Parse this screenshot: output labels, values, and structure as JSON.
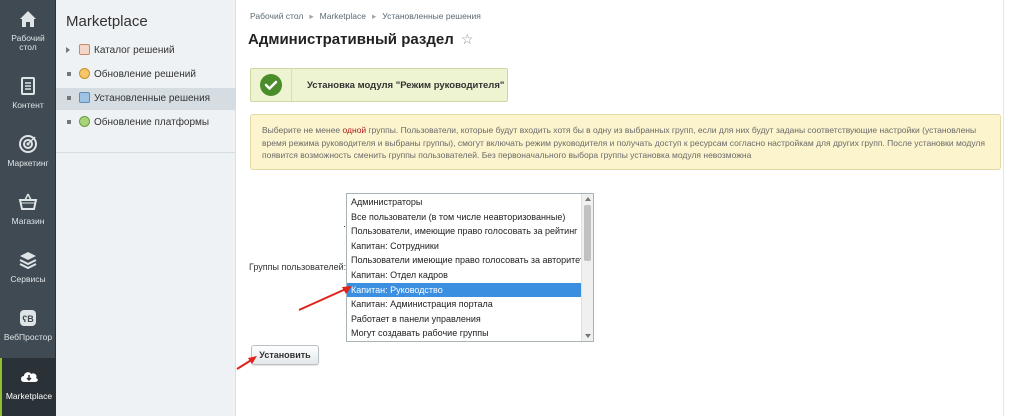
{
  "nav": {
    "items": [
      {
        "label": "Рабочий стол",
        "icon": "home-icon"
      },
      {
        "label": "Контент",
        "icon": "document-icon"
      },
      {
        "label": "Маркетинг",
        "icon": "target-icon"
      },
      {
        "label": "Магазин",
        "icon": "basket-icon"
      },
      {
        "label": "Сервисы",
        "icon": "layers-icon"
      },
      {
        "label": "ВебПростор",
        "icon": "webprostor-icon"
      },
      {
        "label": "Marketplace",
        "icon": "cloud-download-icon",
        "active": true
      }
    ]
  },
  "submenu": {
    "title": "Marketplace",
    "items": [
      {
        "label": "Каталог решений",
        "icon": "catalog-icon"
      },
      {
        "label": "Обновление решений",
        "icon": "update-icon"
      },
      {
        "label": "Установленные решения",
        "icon": "installed-icon",
        "selected": true
      },
      {
        "label": "Обновление платформы",
        "icon": "platform-icon"
      }
    ]
  },
  "breadcrumb": [
    "Рабочий стол",
    "Marketplace",
    "Установленные решения"
  ],
  "page": {
    "title": "Административный раздел"
  },
  "success": {
    "message": "Установка модуля \"Режим руководителя\""
  },
  "warning": {
    "before": "Выберите не менее ",
    "highlight": "одной",
    "after": " группы. Пользователи, которые будут входить хотя бы в одну из выбранных групп, если для них будут заданы соответствующие настройки (установлены время режима руководителя и выбраны группы), смогут включать режим руководителя и получать доступ к ресурсам согласно настройкам для других групп. После установки модуля появится возможность сменить группы пользователей. Без первоначального выбора группы установка модуля невозможна"
  },
  "form": {
    "groups_label": "Группы пользователей:",
    "options": [
      "Администраторы",
      "Все пользователи (в том числе неавторизованные)",
      "Пользователи, имеющие право голосовать за рейтинг",
      "Капитан: Сотрудники",
      "Пользователи имеющие право голосовать за авторитет",
      "Капитан: Отдел кадров",
      "Капитан: Руководство",
      "Капитан: Администрация портала",
      "Работает в панели управления",
      "Могут создавать рабочие группы"
    ],
    "selected_index": 6,
    "install_button": "Установить"
  },
  "colors": {
    "nav_bg": "#3f4a52",
    "accent_green": "#4b8c2b",
    "selection_blue": "#3b8fe1",
    "annotation_red": "#e0221b"
  }
}
